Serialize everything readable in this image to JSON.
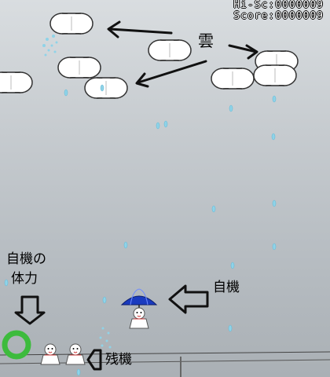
{
  "hud": {
    "hiscore": "Hi-Sc:0000009",
    "score": "Score:0000009"
  },
  "annotations": {
    "cloud": "雲",
    "player": "自機",
    "player_hp_line1": "自機の",
    "player_hp_line2": "体力",
    "lives": "残機"
  },
  "game": {
    "lives_remaining": 2,
    "hp_gauge_fraction": 1.0
  },
  "colors": {
    "hp_ring": "#3dbb3d",
    "umbrella": "#1a3bbf",
    "raindrop": "#8fd3e8",
    "cloud_fill": "#ffffff",
    "cloud_outline": "#333333",
    "arrow": "#111111"
  }
}
